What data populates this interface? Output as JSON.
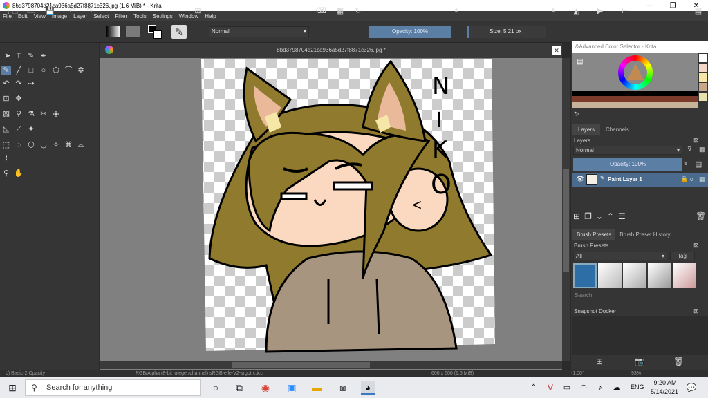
{
  "window": {
    "title": "8bd3798704d21ca936a5d27f8871c326.jpg (1.6 MiB)  * - Krita"
  },
  "menu": [
    "File",
    "Edit",
    "View",
    "Image",
    "Layer",
    "Select",
    "Filter",
    "Tools",
    "Settings",
    "Window",
    "Help"
  ],
  "toolbar": {
    "blend_mode": "Normal",
    "opacity_label": "Opacity: 100%",
    "size_label": "Size: 5.21 px"
  },
  "document": {
    "tab_title": "8bd3798704d21ca936a5d27f8871c326.jpg *"
  },
  "canvas_text": [
    "N",
    "I",
    "K",
    "O"
  ],
  "color_selector": {
    "title": "Advanced Color Selector - Krita"
  },
  "layers_docker": {
    "tabs": [
      "Layers",
      "Channels"
    ],
    "header": "Layers",
    "blend_mode": "Normal",
    "opacity_label": "Opacity: 100%",
    "layer_name": "Paint Layer 1"
  },
  "brush_presets": {
    "tabs": [
      "Brush Presets",
      "Brush Preset History"
    ],
    "header": "Brush Presets",
    "filter": "All",
    "tag_label": "Tag",
    "search_placeholder": "Search"
  },
  "snapshot_docker": {
    "title": "Snapshot Docker"
  },
  "status": {
    "brush": "b) Basic-2 Opacity",
    "color_space": "RGB/Alpha (8-bit integer/channel)  sRGB-elle-V2-srgbtrc.icc",
    "image_size": "600 x 600 (1.6 MiB)",
    "rotation": "-1.00°",
    "zoom": "93%"
  },
  "taskbar": {
    "search_placeholder": "Search for anything",
    "lang": "ENG",
    "time": "9:20 AM",
    "date": "5/14/2021"
  },
  "colors": {
    "accent": "#5b7ea5",
    "hair": "#907a2e",
    "skin": "#fbd9c0",
    "hoodie": "#a89580",
    "ear_inner": "#e9b99a"
  }
}
